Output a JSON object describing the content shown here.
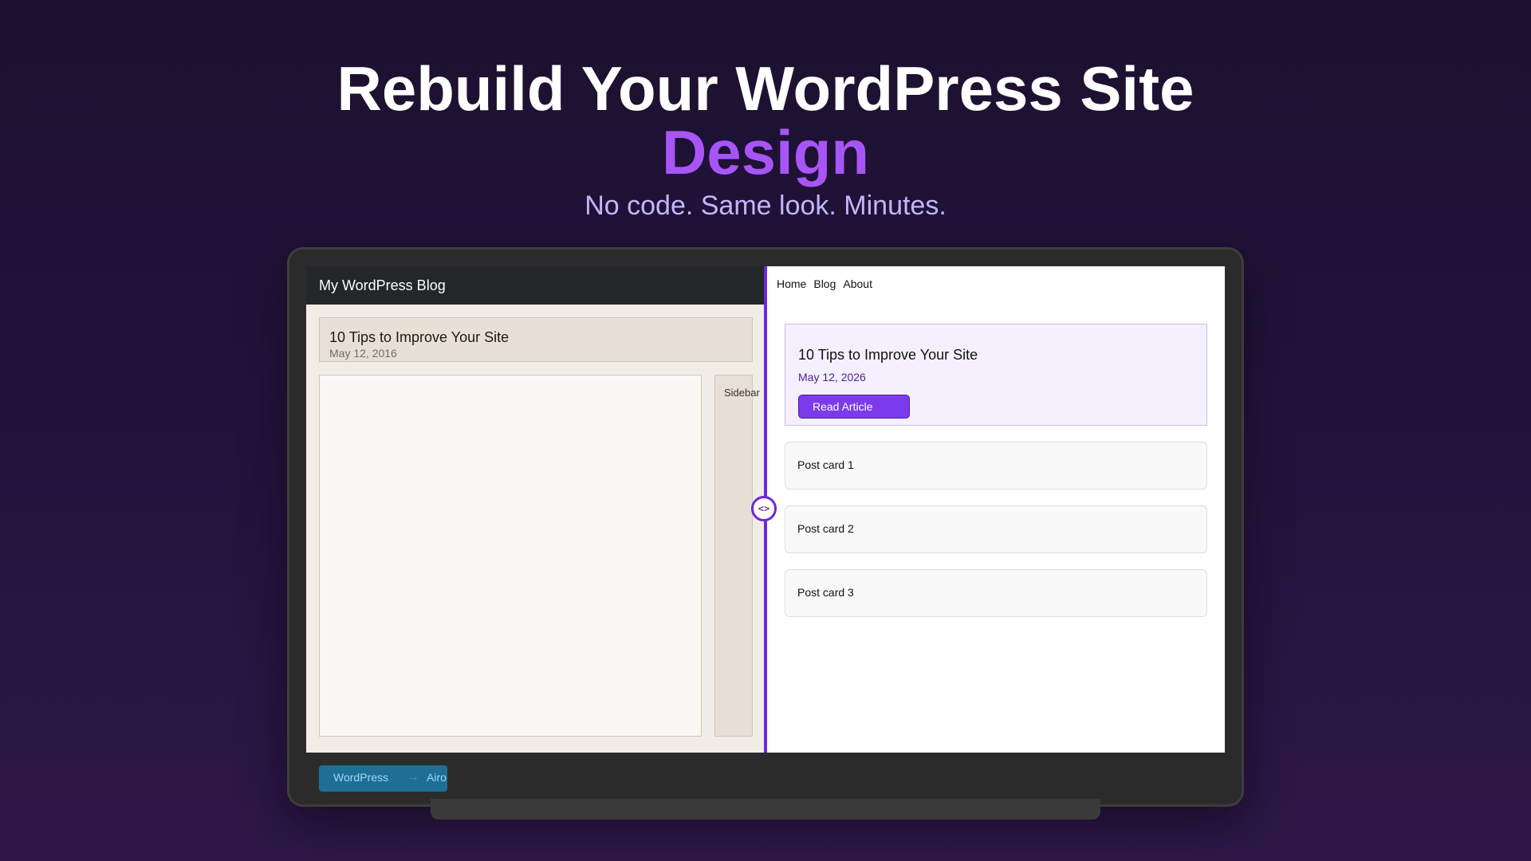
{
  "headline": {
    "line1": "Rebuild Your WordPress Site",
    "line2": "Design",
    "subheadline": "No code. Same look. Minutes."
  },
  "old_site": {
    "site_title": "My WordPress Blog",
    "post_title": "10 Tips to Improve Your Site",
    "post_date": "May 12, 2016",
    "sidebar_label": "Sidebar"
  },
  "divider": {
    "handle_label": "<>"
  },
  "new_site": {
    "nav": [
      "Home",
      "Blog",
      "About"
    ],
    "hero": {
      "title": "10 Tips to Improve Your Site",
      "date": "May 12, 2026",
      "button_label": "Read Article"
    },
    "cards": [
      "Post card 1",
      "Post card 2",
      "Post card 3"
    ]
  },
  "badge": {
    "from": "WordPress",
    "arrow": "→",
    "to": "Airo"
  },
  "colors": {
    "accent": "#a855f7",
    "divider": "#6d28d9",
    "button": "#7c3aed",
    "badge_bg": "#1f6e96"
  }
}
